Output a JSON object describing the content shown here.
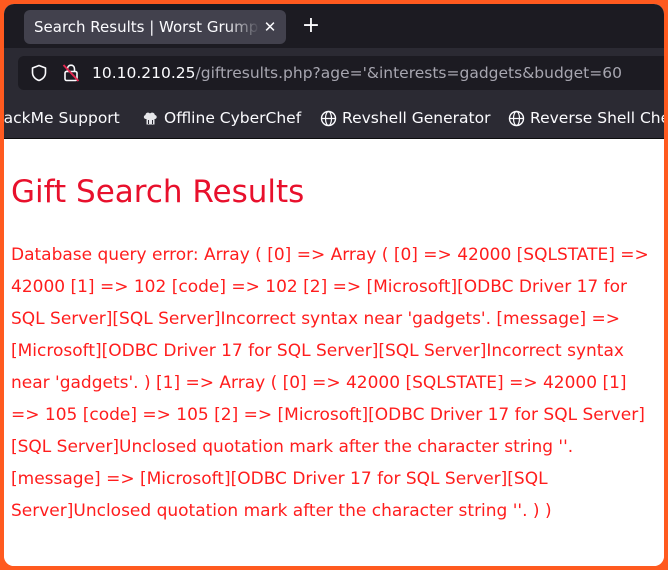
{
  "browser": {
    "tab": {
      "title": "Search Results | Worst Grumpy",
      "close_icon": "close-icon"
    },
    "new_tab_icon": "plus-icon",
    "url": {
      "host": "10.10.210.25",
      "path": "/giftresults.php?age='&interests=gadgets&budget=60"
    },
    "bookmarks": [
      {
        "label": "HackMe Support",
        "icon": "none"
      },
      {
        "label": "Offline CyberChef",
        "icon": "chef-icon"
      },
      {
        "label": "Revshell Generator",
        "icon": "globe-icon"
      },
      {
        "label": "Reverse Shell Cheat",
        "icon": "globe-icon"
      }
    ]
  },
  "page": {
    "title": "Gift Search Results",
    "error": "Database query error: Array ( [0] => Array ( [0] => 42000 [SQLSTATE] => 42000 [1] => 102 [code] => 102 [2] => [Microsoft][ODBC Driver 17 for SQL Server][SQL Server]Incorrect syntax near 'gadgets'. [message] => [Microsoft][ODBC Driver 17 for SQL Server][SQL Server]Incorrect syntax near 'gadgets'. ) [1] => Array ( [0] => 42000 [SQLSTATE] => 42000 [1] => 105 [code] => 105 [2] => [Microsoft][ODBC Driver 17 for SQL Server][SQL Server]Unclosed quotation mark after the character string ''. [message] => [Microsoft][ODBC Driver 17 for SQL Server][SQL Server]Unclosed quotation mark after the character string ''. ) )"
  },
  "colors": {
    "border": "#ff5a1f",
    "title": "#e8102c",
    "error_text": "#ff1d1d",
    "chrome_dark": "#1c1b22",
    "chrome": "#2b2a33"
  }
}
